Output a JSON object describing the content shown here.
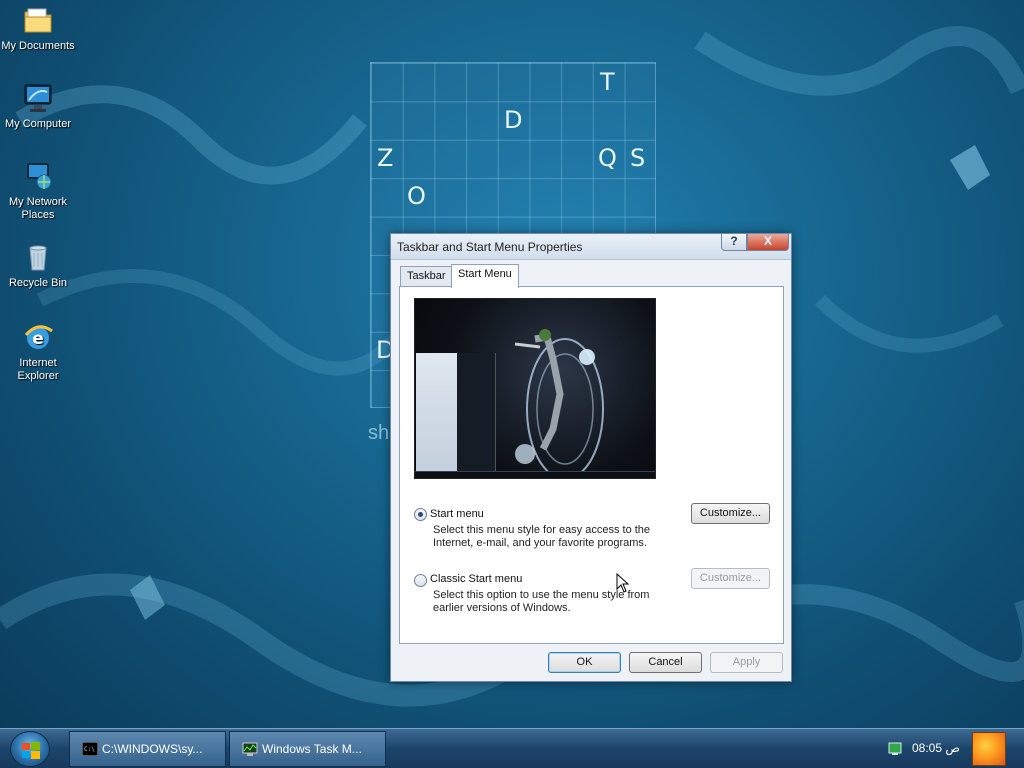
{
  "desktop": {
    "icons": [
      {
        "label": "My Documents",
        "icon": "my-documents-icon"
      },
      {
        "label": "My Computer",
        "icon": "my-computer-icon"
      },
      {
        "label": "My Network Places",
        "icon": "my-network-places-icon"
      },
      {
        "label": "Recycle Bin",
        "icon": "recycle-bin-icon"
      },
      {
        "label": "Internet Explorer",
        "icon": "internet-explorer-icon"
      }
    ],
    "grid_letters": [
      "T",
      "D",
      "Z",
      "Q",
      "S",
      "O",
      "D"
    ],
    "grid_caption": "sh"
  },
  "dialog": {
    "title": "Taskbar and Start Menu Properties",
    "help_button": "?",
    "close_button": "X",
    "tabs": [
      {
        "label": "Taskbar",
        "active": false
      },
      {
        "label": "Start Menu",
        "active": true
      }
    ],
    "options": [
      {
        "label": "Start menu",
        "description": "Select this menu style for easy access to the Internet, e-mail, and your favorite programs.",
        "checked": true,
        "customize_label": "Customize...",
        "customize_enabled": true
      },
      {
        "label": "Classic Start menu",
        "description": "Select this option to use the menu style from earlier versions of Windows.",
        "checked": false,
        "customize_label": "Customize...",
        "customize_enabled": false
      }
    ],
    "buttons": {
      "ok": "OK",
      "cancel": "Cancel",
      "apply": "Apply"
    }
  },
  "taskbar": {
    "items": [
      {
        "label": "C:\\WINDOWS\\sy...",
        "icon": "command-prompt-icon"
      },
      {
        "label": "Windows Task M...",
        "icon": "task-manager-icon"
      }
    ],
    "clock": {
      "time": "08:05",
      "period": "ص"
    }
  },
  "colors": {
    "taskbar": "#1d456b",
    "close_button": "#c7452d",
    "wallpaper": "#17668f"
  }
}
